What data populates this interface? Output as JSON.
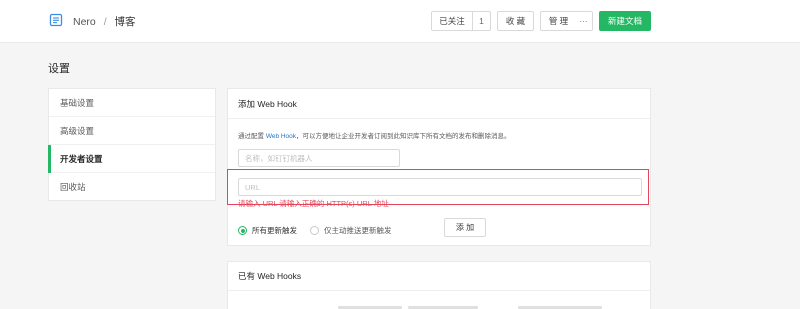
{
  "header": {
    "breadcrumb": {
      "user": "Nero",
      "separator": "/",
      "current": "博客"
    },
    "actions": {
      "follow_label": "已关注",
      "follow_count": "1",
      "star_label": "收 藏",
      "manage_label": "管 理",
      "more_label": "···",
      "new_doc_label": "新建文档"
    }
  },
  "page": {
    "title": "设置"
  },
  "sidebar": {
    "items": [
      {
        "label": "基础设置"
      },
      {
        "label": "高级设置"
      },
      {
        "label": "开发者设置"
      },
      {
        "label": "回收站"
      }
    ],
    "active_index": 2
  },
  "webhook_form": {
    "title": "添加 Web Hook",
    "desc_prefix": "通过配置 ",
    "desc_link": "Web Hook",
    "desc_suffix": "，可以方便地让企业开发者订阅到此知识库下所有文档的发布和删除消息。",
    "name_placeholder": "名称，如钉钉机器人",
    "url_placeholder": "URL",
    "url_value": "",
    "error_text": "请输入 URL 请输入正确的 HTTP(s) URL 地址",
    "radio_all_label": "所有更新触发",
    "radio_manual_label": "仅主动推送更新触发",
    "radio_selected": "all",
    "add_button_label": "添 加"
  },
  "existing_hooks": {
    "title": "已有 Web Hooks"
  },
  "colors": {
    "accent_green": "#25b864",
    "error_red": "#e3455b",
    "link_blue": "#1f76c8"
  }
}
